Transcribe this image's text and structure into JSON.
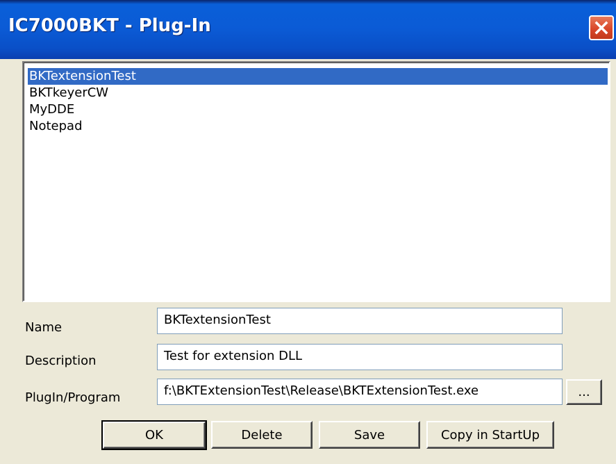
{
  "window": {
    "title": "IC7000BKT - Plug-In",
    "close_icon": "close-icon"
  },
  "plugin_list": {
    "items": [
      {
        "label": "BKTextensionTest",
        "selected": true
      },
      {
        "label": "BKTkeyerCW",
        "selected": false
      },
      {
        "label": "MyDDE",
        "selected": false
      },
      {
        "label": "Notepad",
        "selected": false
      }
    ]
  },
  "form": {
    "name_label": "Name",
    "name_value": "BKTextensionTest",
    "description_label": "Description",
    "description_value": "Test for extension DLL",
    "program_label": "PlugIn/Program",
    "program_value": "f:\\BKTExtensionTest\\Release\\BKTExtensionTest.exe",
    "browse_label": "..."
  },
  "buttons": {
    "ok": "OK",
    "delete": "Delete",
    "save": "Save",
    "copy_startup": "Copy in StartUp"
  },
  "colors": {
    "selection": "#316AC5",
    "titlebar": "#0B5BD6",
    "close": "#D9472A",
    "dialog_bg": "#ECE9D8"
  }
}
